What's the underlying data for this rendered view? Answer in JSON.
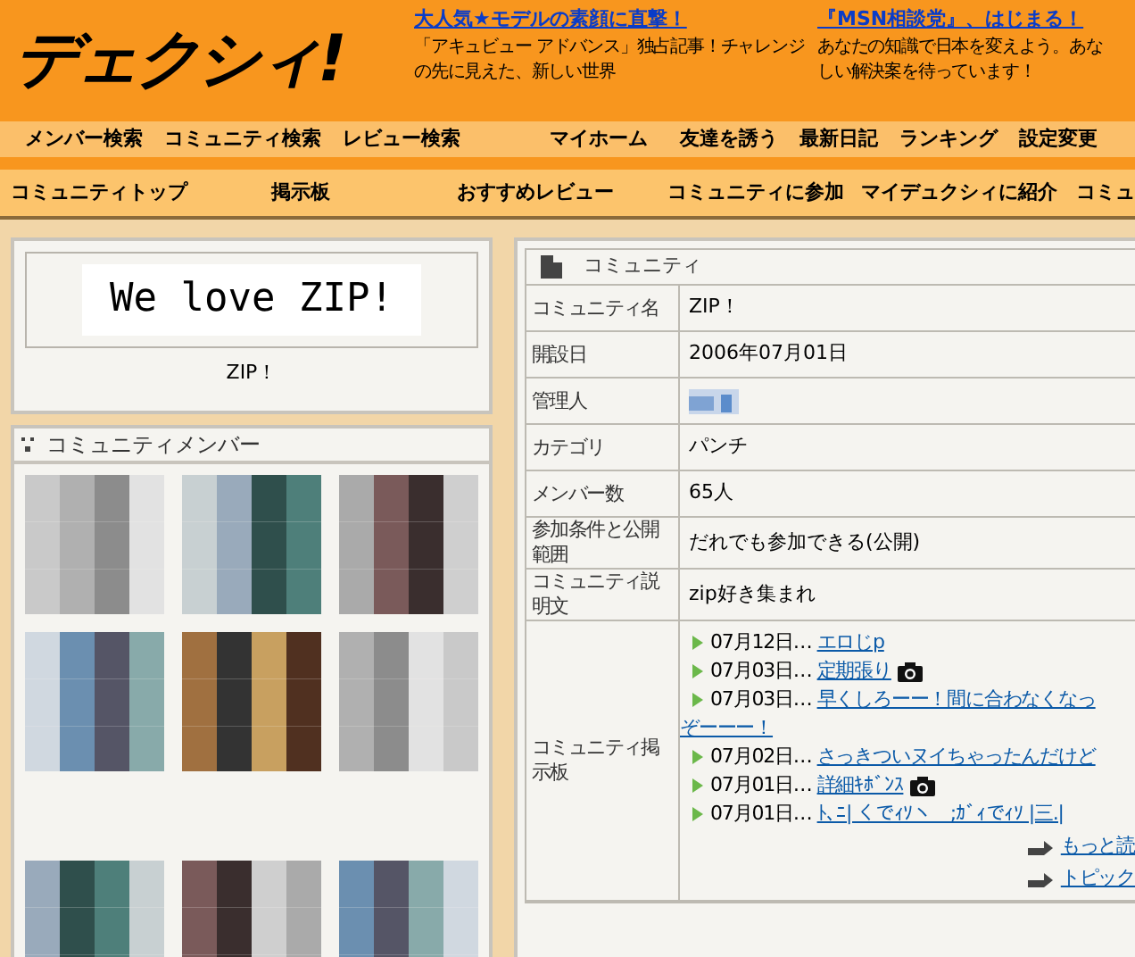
{
  "logo": "デェクシィ!",
  "promos": [
    {
      "title": "大人気★モデルの素顔に直撃！",
      "lines": [
        "「アキュビュー アドバンス」独占記事！チャレンジ",
        "の先に見えた、新しい世界"
      ]
    },
    {
      "title": "『MSN相談党』、はじまる！",
      "lines": [
        "あなたの知識で日本を変えよう。あな",
        "しい解決案を待っています！"
      ]
    }
  ],
  "main_nav": [
    "メンバー検索",
    "コミュニティ検索",
    "レビュー検索",
    "マイホーム",
    "友達を誘う",
    "最新日記",
    "ランキング",
    "設定変更"
  ],
  "sub_nav": [
    "コミュニティトップ",
    "掲示板",
    "おすすめレビュー",
    "コミュニティに参加",
    "マイデュクシィに紹介",
    "コミュ"
  ],
  "community_image": {
    "text": "We love ZIP!",
    "caption": "ZIP！"
  },
  "members_panel": {
    "title": "コミュニティメンバー"
  },
  "info": {
    "title": "コミュニティ",
    "rows": [
      {
        "label": "コミュニティ名",
        "value": "ZIP！",
        "kind": "text"
      },
      {
        "label": "開設日",
        "value": "2006年07月01日",
        "kind": "text"
      },
      {
        "label": "管理人",
        "kind": "hidden"
      },
      {
        "label": "カテゴリ",
        "value": "パンチ",
        "kind": "text"
      },
      {
        "label": "メンバー数",
        "value": "65人",
        "kind": "text"
      },
      {
        "label": "参加条件と公開範囲",
        "value": "だれでも参加できる(公開)",
        "kind": "text"
      },
      {
        "label": "コミュニティ説明文",
        "value": "zip好き集まれ",
        "kind": "text"
      },
      {
        "label": "コミュニティ掲示板",
        "kind": "topics"
      }
    ]
  },
  "topics": [
    {
      "date": "07月12日…",
      "title": "エロじp",
      "photo": false
    },
    {
      "date": "07月03日…",
      "title": "定期張り",
      "photo": true
    },
    {
      "date": "07月03日…",
      "title": "早くしろーー！間に合わなくなっ",
      "continuation": "ぞーーー！",
      "photo": false
    },
    {
      "date": "07月02日…",
      "title": "さっきついヌイちゃったんだけど",
      "photo": false
    },
    {
      "date": "07月01日…",
      "title": "詳細ｷﾎﾞﾝｽ",
      "photo": true
    },
    {
      "date": "07月01日…",
      "title": "ﾄ､ﾆ| くでｨｿヽ　;ｶﾞｨでｨｿ |三.|",
      "photo": false
    }
  ],
  "more_links": [
    "もっと読",
    "トピック"
  ]
}
